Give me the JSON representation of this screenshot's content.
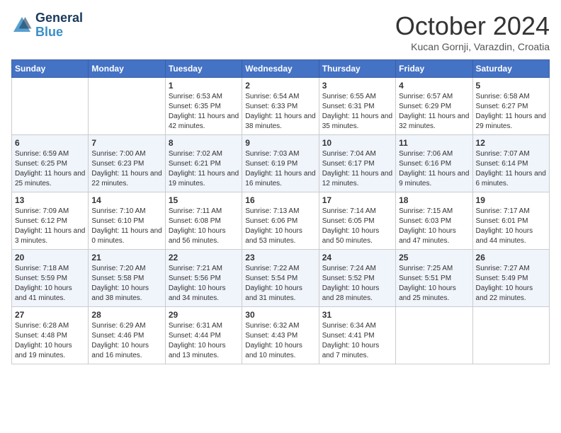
{
  "header": {
    "logo_line1": "General",
    "logo_line2": "Blue",
    "month": "October 2024",
    "location": "Kucan Gornji, Varazdin, Croatia"
  },
  "days_of_week": [
    "Sunday",
    "Monday",
    "Tuesday",
    "Wednesday",
    "Thursday",
    "Friday",
    "Saturday"
  ],
  "weeks": [
    [
      {
        "day": "",
        "content": ""
      },
      {
        "day": "",
        "content": ""
      },
      {
        "day": "1",
        "content": "Sunrise: 6:53 AM\nSunset: 6:35 PM\nDaylight: 11 hours and 42 minutes."
      },
      {
        "day": "2",
        "content": "Sunrise: 6:54 AM\nSunset: 6:33 PM\nDaylight: 11 hours and 38 minutes."
      },
      {
        "day": "3",
        "content": "Sunrise: 6:55 AM\nSunset: 6:31 PM\nDaylight: 11 hours and 35 minutes."
      },
      {
        "day": "4",
        "content": "Sunrise: 6:57 AM\nSunset: 6:29 PM\nDaylight: 11 hours and 32 minutes."
      },
      {
        "day": "5",
        "content": "Sunrise: 6:58 AM\nSunset: 6:27 PM\nDaylight: 11 hours and 29 minutes."
      }
    ],
    [
      {
        "day": "6",
        "content": "Sunrise: 6:59 AM\nSunset: 6:25 PM\nDaylight: 11 hours and 25 minutes."
      },
      {
        "day": "7",
        "content": "Sunrise: 7:00 AM\nSunset: 6:23 PM\nDaylight: 11 hours and 22 minutes."
      },
      {
        "day": "8",
        "content": "Sunrise: 7:02 AM\nSunset: 6:21 PM\nDaylight: 11 hours and 19 minutes."
      },
      {
        "day": "9",
        "content": "Sunrise: 7:03 AM\nSunset: 6:19 PM\nDaylight: 11 hours and 16 minutes."
      },
      {
        "day": "10",
        "content": "Sunrise: 7:04 AM\nSunset: 6:17 PM\nDaylight: 11 hours and 12 minutes."
      },
      {
        "day": "11",
        "content": "Sunrise: 7:06 AM\nSunset: 6:16 PM\nDaylight: 11 hours and 9 minutes."
      },
      {
        "day": "12",
        "content": "Sunrise: 7:07 AM\nSunset: 6:14 PM\nDaylight: 11 hours and 6 minutes."
      }
    ],
    [
      {
        "day": "13",
        "content": "Sunrise: 7:09 AM\nSunset: 6:12 PM\nDaylight: 11 hours and 3 minutes."
      },
      {
        "day": "14",
        "content": "Sunrise: 7:10 AM\nSunset: 6:10 PM\nDaylight: 11 hours and 0 minutes."
      },
      {
        "day": "15",
        "content": "Sunrise: 7:11 AM\nSunset: 6:08 PM\nDaylight: 10 hours and 56 minutes."
      },
      {
        "day": "16",
        "content": "Sunrise: 7:13 AM\nSunset: 6:06 PM\nDaylight: 10 hours and 53 minutes."
      },
      {
        "day": "17",
        "content": "Sunrise: 7:14 AM\nSunset: 6:05 PM\nDaylight: 10 hours and 50 minutes."
      },
      {
        "day": "18",
        "content": "Sunrise: 7:15 AM\nSunset: 6:03 PM\nDaylight: 10 hours and 47 minutes."
      },
      {
        "day": "19",
        "content": "Sunrise: 7:17 AM\nSunset: 6:01 PM\nDaylight: 10 hours and 44 minutes."
      }
    ],
    [
      {
        "day": "20",
        "content": "Sunrise: 7:18 AM\nSunset: 5:59 PM\nDaylight: 10 hours and 41 minutes."
      },
      {
        "day": "21",
        "content": "Sunrise: 7:20 AM\nSunset: 5:58 PM\nDaylight: 10 hours and 38 minutes."
      },
      {
        "day": "22",
        "content": "Sunrise: 7:21 AM\nSunset: 5:56 PM\nDaylight: 10 hours and 34 minutes."
      },
      {
        "day": "23",
        "content": "Sunrise: 7:22 AM\nSunset: 5:54 PM\nDaylight: 10 hours and 31 minutes."
      },
      {
        "day": "24",
        "content": "Sunrise: 7:24 AM\nSunset: 5:52 PM\nDaylight: 10 hours and 28 minutes."
      },
      {
        "day": "25",
        "content": "Sunrise: 7:25 AM\nSunset: 5:51 PM\nDaylight: 10 hours and 25 minutes."
      },
      {
        "day": "26",
        "content": "Sunrise: 7:27 AM\nSunset: 5:49 PM\nDaylight: 10 hours and 22 minutes."
      }
    ],
    [
      {
        "day": "27",
        "content": "Sunrise: 6:28 AM\nSunset: 4:48 PM\nDaylight: 10 hours and 19 minutes."
      },
      {
        "day": "28",
        "content": "Sunrise: 6:29 AM\nSunset: 4:46 PM\nDaylight: 10 hours and 16 minutes."
      },
      {
        "day": "29",
        "content": "Sunrise: 6:31 AM\nSunset: 4:44 PM\nDaylight: 10 hours and 13 minutes."
      },
      {
        "day": "30",
        "content": "Sunrise: 6:32 AM\nSunset: 4:43 PM\nDaylight: 10 hours and 10 minutes."
      },
      {
        "day": "31",
        "content": "Sunrise: 6:34 AM\nSunset: 4:41 PM\nDaylight: 10 hours and 7 minutes."
      },
      {
        "day": "",
        "content": ""
      },
      {
        "day": "",
        "content": ""
      }
    ]
  ]
}
